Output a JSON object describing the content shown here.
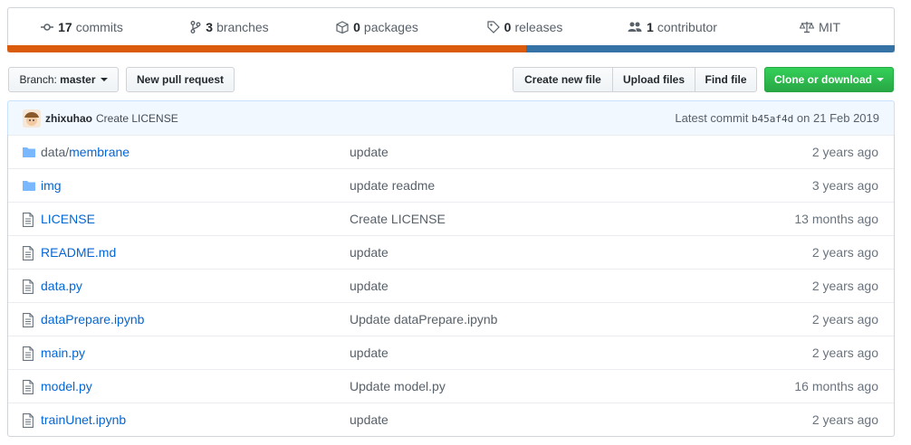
{
  "summary": {
    "commits": {
      "count": "17",
      "label": "commits"
    },
    "branches": {
      "count": "3",
      "label": "branches"
    },
    "packages": {
      "count": "0",
      "label": "packages"
    },
    "releases": {
      "count": "0",
      "label": "releases"
    },
    "contributors": {
      "count": "1",
      "label": "contributor"
    },
    "license": {
      "label": "MIT"
    }
  },
  "language_bar": [
    {
      "color": "#DA5B0B",
      "fraction": 0.585
    },
    {
      "color": "#3572A5",
      "fraction": 0.415
    }
  ],
  "toolbar": {
    "branch_prefix": "Branch:",
    "branch_name": "master",
    "new_pr": "New pull request",
    "create_file": "Create new file",
    "upload_files": "Upload files",
    "find_file": "Find file",
    "clone": "Clone or download"
  },
  "commit": {
    "author": "zhixuhao",
    "message": "Create LICENSE",
    "latest_label": "Latest commit",
    "sha": "b45af4d",
    "date": "on 21 Feb 2019"
  },
  "files": [
    {
      "type": "dir",
      "dir": "data/",
      "name": "membrane",
      "message": "update",
      "age": "2 years ago"
    },
    {
      "type": "dir",
      "dir": "",
      "name": "img",
      "message": "update readme",
      "age": "3 years ago"
    },
    {
      "type": "file",
      "dir": "",
      "name": "LICENSE",
      "message": "Create LICENSE",
      "age": "13 months ago"
    },
    {
      "type": "file",
      "dir": "",
      "name": "README.md",
      "message": "update",
      "age": "2 years ago"
    },
    {
      "type": "file",
      "dir": "",
      "name": "data.py",
      "message": "update",
      "age": "2 years ago"
    },
    {
      "type": "file",
      "dir": "",
      "name": "dataPrepare.ipynb",
      "message": "Update dataPrepare.ipynb",
      "age": "2 years ago"
    },
    {
      "type": "file",
      "dir": "",
      "name": "main.py",
      "message": "update",
      "age": "2 years ago"
    },
    {
      "type": "file",
      "dir": "",
      "name": "model.py",
      "message": "Update model.py",
      "age": "16 months ago"
    },
    {
      "type": "file",
      "dir": "",
      "name": "trainUnet.ipynb",
      "message": "update",
      "age": "2 years ago"
    }
  ],
  "colors": {
    "link": "#0366d6",
    "folder": "#79b8ff",
    "green": "#28a745"
  }
}
